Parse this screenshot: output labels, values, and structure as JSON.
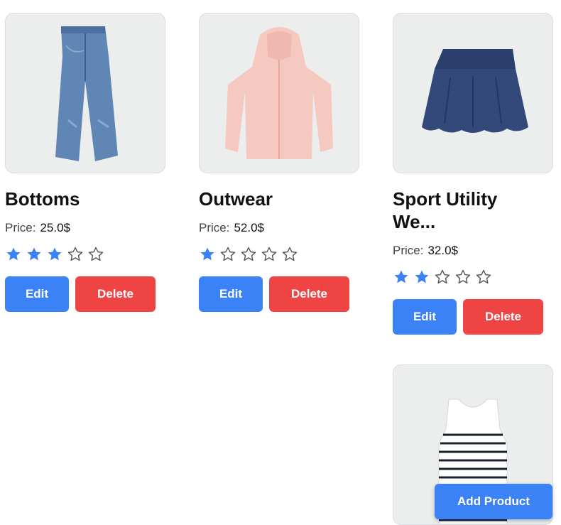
{
  "colors": {
    "primary": "#3b82f6",
    "danger": "#ef4444",
    "star_filled": "#3b82f6",
    "star_empty_outline": "#555555"
  },
  "products": [
    {
      "title": "Bottoms",
      "price_label": "Price:",
      "price_value": "25.0$",
      "rating": 3,
      "rating_max": 5,
      "edit_label": "Edit",
      "delete_label": "Delete",
      "image": "jeans-image"
    },
    {
      "title": "Outwear",
      "price_label": "Price:",
      "price_value": "52.0$",
      "rating": 1,
      "rating_max": 5,
      "edit_label": "Edit",
      "delete_label": "Delete",
      "image": "jacket-image"
    },
    {
      "title": "Sport Utility We...",
      "price_label": "Price:",
      "price_value": "32.0$",
      "rating": 2,
      "rating_max": 5,
      "edit_label": "Edit",
      "delete_label": "Delete",
      "image": "skirt-image"
    },
    {
      "title": "",
      "image": "tank-top-image"
    }
  ],
  "add_product_label": "Add Product"
}
